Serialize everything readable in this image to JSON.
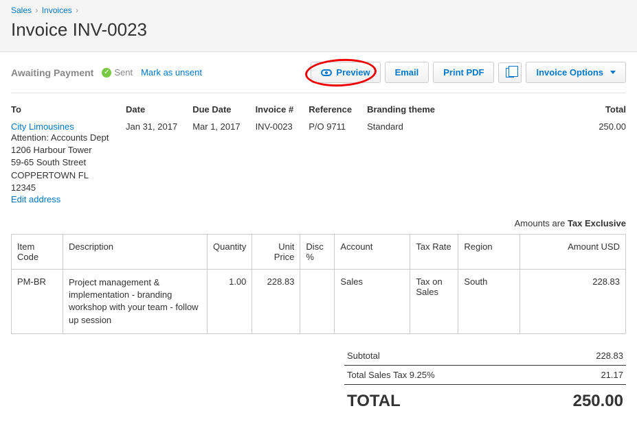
{
  "breadcrumb": {
    "sales": "Sales",
    "invoices": "Invoices"
  },
  "page_title": "Invoice INV-0023",
  "status": {
    "awaiting": "Awaiting Payment",
    "sent": "Sent",
    "mark_unsent": "Mark as unsent"
  },
  "buttons": {
    "preview": "Preview",
    "email": "Email",
    "print_pdf": "Print PDF",
    "invoice_options": "Invoice Options"
  },
  "info": {
    "labels": {
      "to": "To",
      "date": "Date",
      "due_date": "Due Date",
      "invoice_no": "Invoice #",
      "reference": "Reference",
      "branding": "Branding theme",
      "total": "Total"
    },
    "to_name": "City Limousines",
    "attention": "Attention: Accounts Dept",
    "addr1": "1206 Harbour Tower",
    "addr2": "59-65 South Street",
    "addr3": "COPPERTOWN FL 12345",
    "edit_address": "Edit address",
    "date": "Jan 31, 2017",
    "due_date": "Mar 1, 2017",
    "invoice_no": "INV-0023",
    "reference": "P/O 9711",
    "branding": "Standard",
    "total": "250.00"
  },
  "amounts_prefix": "Amounts are ",
  "amounts_type": "Tax Exclusive",
  "table": {
    "headers": {
      "item_code": "Item Code",
      "description": "Description",
      "quantity": "Quantity",
      "unit_price": "Unit Price",
      "disc": "Disc %",
      "account": "Account",
      "tax_rate": "Tax Rate",
      "region": "Region",
      "amount": "Amount USD"
    },
    "row": {
      "item_code": "PM-BR",
      "description": "Project management & implementation - branding workshop with your team - follow up session",
      "quantity": "1.00",
      "unit_price": "228.83",
      "disc": "",
      "account": "Sales",
      "tax_rate": "Tax on Sales",
      "region": "South",
      "amount": "228.83"
    }
  },
  "totals": {
    "subtotal_label": "Subtotal",
    "subtotal": "228.83",
    "tax_label": "Total Sales Tax 9.25%",
    "tax": "21.17",
    "total_label": "TOTAL",
    "total": "250.00"
  }
}
